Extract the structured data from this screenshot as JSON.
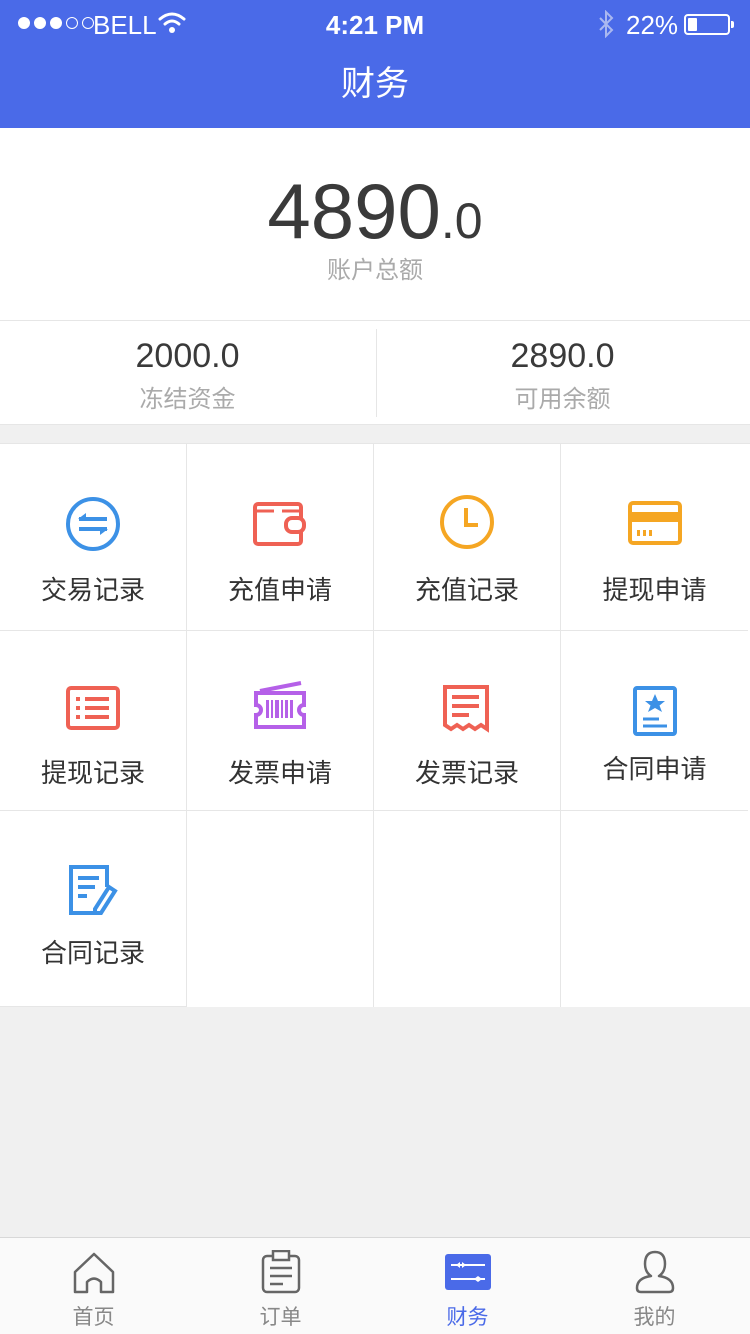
{
  "status_bar": {
    "signal_dots_filled": 3,
    "signal_dots_total": 5,
    "carrier": "BELL",
    "time": "4:21 PM",
    "battery": "22%",
    "battery_level": 0.22
  },
  "header": {
    "title": "财务"
  },
  "account": {
    "total_integer": "4890",
    "total_decimal": ".0",
    "total_label": "账户总额",
    "frozen_value": "2000.0",
    "frozen_label": "冻结资金",
    "available_value": "2890.0",
    "available_label": "可用余额"
  },
  "menu": [
    {
      "label": "交易记录",
      "icon": "exchange-icon",
      "color": "#3c91e6"
    },
    {
      "label": "充值申请",
      "icon": "wallet-icon",
      "color": "#ef6154"
    },
    {
      "label": "充值记录",
      "icon": "clock-icon",
      "color": "#f5a623"
    },
    {
      "label": "提现申请",
      "icon": "card-icon",
      "color": "#f5a623"
    },
    {
      "label": "提现记录",
      "icon": "list-icon",
      "color": "#ef6154"
    },
    {
      "label": "发票申请",
      "icon": "ticket-icon",
      "color": "#b560e8"
    },
    {
      "label": "发票记录",
      "icon": "receipt-icon",
      "color": "#ef6154"
    },
    {
      "label": "合同申请",
      "icon": "contract-star-icon",
      "color": "#3c91e6"
    },
    {
      "label": "合同记录",
      "icon": "contract-edit-icon",
      "color": "#3c91e6"
    }
  ],
  "tabbar": [
    {
      "label": "首页",
      "icon": "home-icon",
      "active": false
    },
    {
      "label": "订单",
      "icon": "clipboard-icon",
      "active": false
    },
    {
      "label": "财务",
      "icon": "finance-icon",
      "active": true
    },
    {
      "label": "我的",
      "icon": "user-icon",
      "active": false
    }
  ],
  "colors": {
    "brand": "#4a6ae8",
    "background": "#f0f0f0",
    "active_tab": "#4a6ae8"
  }
}
